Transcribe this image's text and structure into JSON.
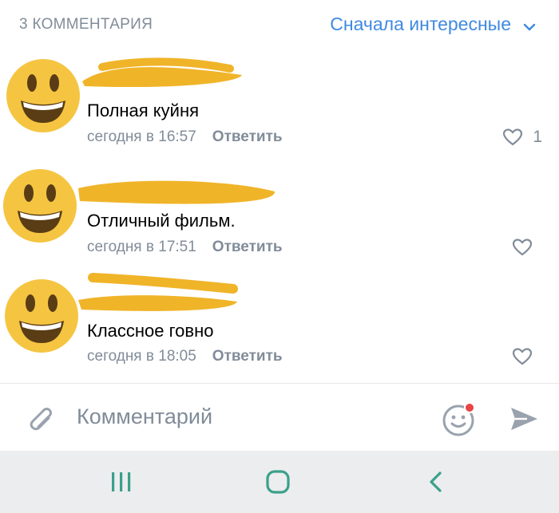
{
  "header": {
    "count_label": "3 КОММЕНТАРИЯ",
    "sort_label": "Сначала интересные",
    "sort_icon": "chevron-down-icon"
  },
  "comments": [
    {
      "text": "Полная куйня",
      "time": "сегодня в 16:57",
      "reply": "Ответить",
      "likes": "1"
    },
    {
      "text": "Отличный фильм.",
      "time": "сегодня в 17:51",
      "reply": "Ответить",
      "likes": ""
    },
    {
      "text": "Классное говно",
      "time": "сегодня в 18:05",
      "reply": "Ответить",
      "likes": ""
    }
  ],
  "composer": {
    "placeholder": "Комментарий",
    "attach_icon": "paperclip-icon",
    "emoji_icon": "smiley-icon",
    "send_icon": "send-icon"
  },
  "navbar": {
    "icons": [
      "recent-apps-icon",
      "home-icon",
      "back-icon"
    ]
  },
  "colors": {
    "accent": "#3f8ae0",
    "secondary_text": "#818c99",
    "avatar_yellow": "#f5c542",
    "redaction": "#f0b429",
    "notification_dot": "#e64646",
    "navbar_bg": "#ecedef"
  }
}
